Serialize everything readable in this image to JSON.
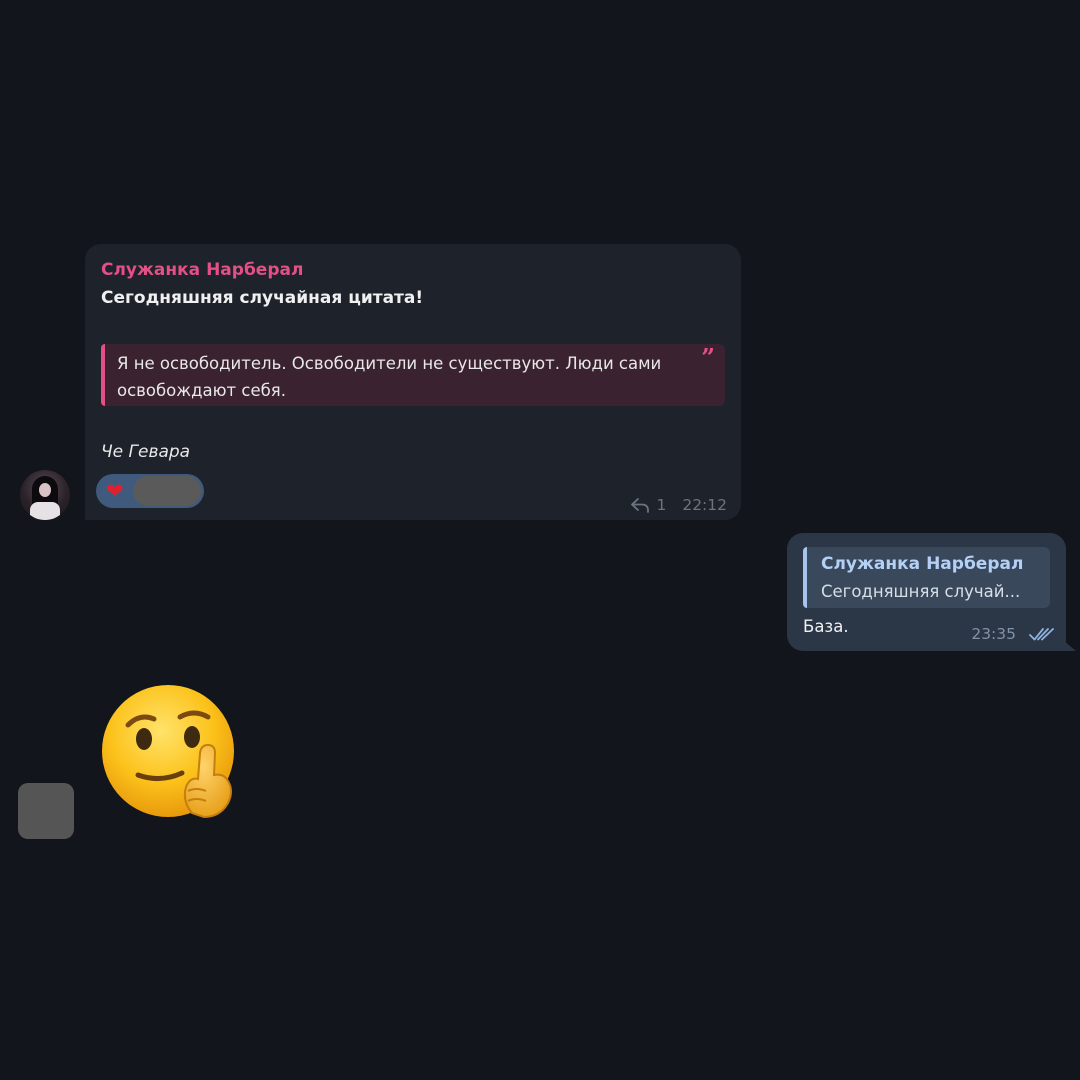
{
  "incoming": {
    "sender": "Служанка Нарберал",
    "title": "Сегодняшняя случайная цитата!",
    "quote": "Я не освободитель. Освободители не существуют. Люди сами освобождают себя.",
    "author": "Че Гевара",
    "reaction_emoji": "❤",
    "reply_count": "1",
    "time": "22:12"
  },
  "outgoing": {
    "reply_to_name": "Служанка Нарберал",
    "reply_to_snippet": "Сегодняшняя случай...",
    "text": "База.",
    "time": "23:35"
  },
  "sticker": {
    "emoji": "thinking-face-emoji"
  },
  "colors": {
    "background": "#12151b",
    "incoming_bubble": "#1d222b",
    "outgoing_bubble": "#2b3646",
    "sender_accent": "#e34f86",
    "reply_accent": "#a8c4ee"
  }
}
